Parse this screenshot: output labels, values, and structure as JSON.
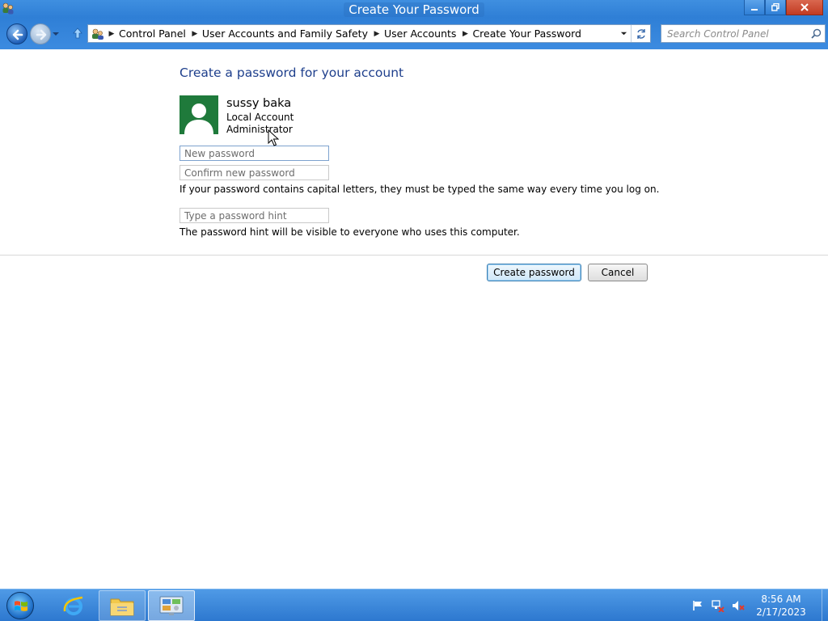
{
  "window": {
    "title": "Create Your Password",
    "title_icon": "user-accounts-icon",
    "controls": [
      "minimize-icon",
      "restore-icon",
      "close-icon"
    ]
  },
  "nav": {
    "breadcrumb": [
      "Control Panel",
      "User Accounts and Family Safety",
      "User Accounts",
      "Create Your Password"
    ],
    "search_placeholder": "Search Control Panel"
  },
  "page": {
    "heading": "Create a password for your account",
    "account": {
      "name": "sussy baka",
      "type": "Local Account",
      "role": "Administrator"
    },
    "fields": {
      "new_password_placeholder": "New password",
      "confirm_password_placeholder": "Confirm new password",
      "hint_placeholder": "Type a password hint"
    },
    "caps_note": "If your password contains capital letters, they must be typed the same way every time you log on.",
    "hint_note": "The password hint will be visible to everyone who uses this computer.",
    "buttons": {
      "create": "Create password",
      "cancel": "Cancel"
    }
  },
  "taskbar": {
    "pinned": [
      "internet-explorer-icon",
      "file-explorer-icon",
      "control-panel-icon"
    ],
    "tray_icons": [
      "action-center-flag-icon",
      "network-icon",
      "volume-muted-icon"
    ],
    "clock": {
      "time": "8:56 AM",
      "date": "2/17/2023"
    }
  },
  "colors": {
    "chrome_blue": "#2f7fd6",
    "heading_blue": "#1e3f8c",
    "avatar_green": "#1f7a3b",
    "close_red": "#c23b22"
  }
}
